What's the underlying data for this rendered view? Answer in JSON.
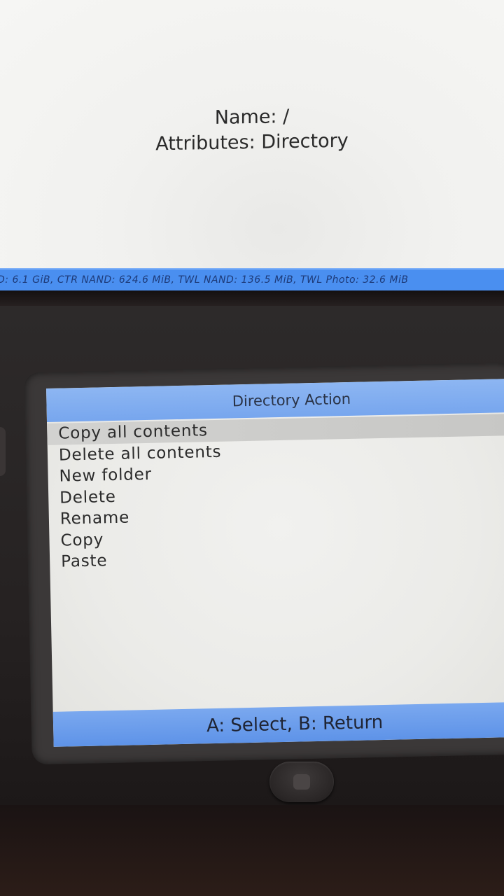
{
  "top_screen": {
    "name_line": "Name: /",
    "attributes_line": "Attributes: Directory",
    "status_text": "D: 6.1 GiB, CTR NAND: 624.6 MiB, TWL NAND: 136.5 MiB, TWL Photo: 32.6 MiB"
  },
  "bottom_screen": {
    "title": "Directory Action",
    "menu": [
      {
        "label": "Copy all contents"
      },
      {
        "label": "Delete all contents"
      },
      {
        "label": "New folder"
      },
      {
        "label": "Delete"
      },
      {
        "label": "Rename"
      },
      {
        "label": "Copy"
      },
      {
        "label": "Paste"
      }
    ],
    "selected_index": 0,
    "footer": "A: Select, B: Return"
  },
  "colors": {
    "accent_blue": "#77a6ee",
    "status_blue": "#4a8ff0",
    "selection_gray": "#c7c7c5"
  },
  "icons": {
    "home_button": "home-icon"
  }
}
